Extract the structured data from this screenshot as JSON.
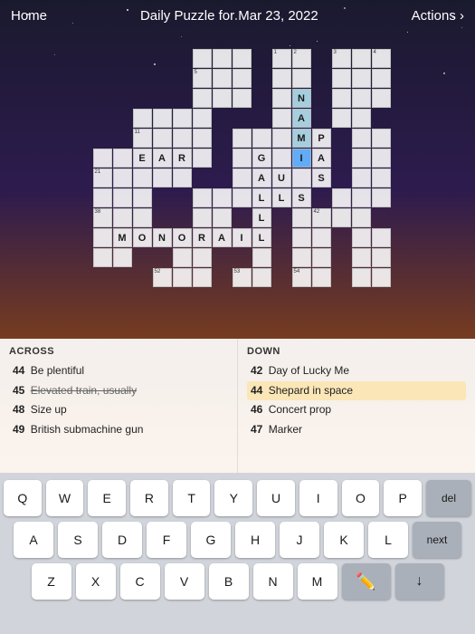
{
  "header": {
    "home_label": "Home",
    "title": "Daily Puzzle for Mar 23, 2022",
    "actions_label": "Actions ›"
  },
  "clues": {
    "across_header": "ACROSS",
    "down_header": "DOWN",
    "across_items": [
      {
        "number": "44",
        "text": "Be plentiful",
        "strikethrough": false
      },
      {
        "number": "45",
        "text": "Elevated train, usually",
        "strikethrough": true
      },
      {
        "number": "48",
        "text": "Size up",
        "strikethrough": false
      },
      {
        "number": "49",
        "text": "British submachine gun",
        "strikethrough": false
      }
    ],
    "down_items": [
      {
        "number": "42",
        "text": "Day of Lucky Me",
        "strikethrough": false
      },
      {
        "number": "44",
        "text": "Shepard in space",
        "strikethrough": false,
        "highlighted": true
      },
      {
        "number": "46",
        "text": "Concert prop",
        "strikethrough": false
      },
      {
        "number": "47",
        "text": "Marker",
        "strikethrough": false
      }
    ]
  },
  "keyboard": {
    "row1": [
      "Q",
      "W",
      "E",
      "R",
      "T",
      "Y",
      "U",
      "I",
      "O",
      "P"
    ],
    "row2": [
      "A",
      "S",
      "D",
      "F",
      "G",
      "H",
      "J",
      "K",
      "L"
    ],
    "row3": [
      "Z",
      "X",
      "C",
      "V",
      "B",
      "N",
      "M"
    ],
    "del_label": "del",
    "next_label": "next"
  }
}
